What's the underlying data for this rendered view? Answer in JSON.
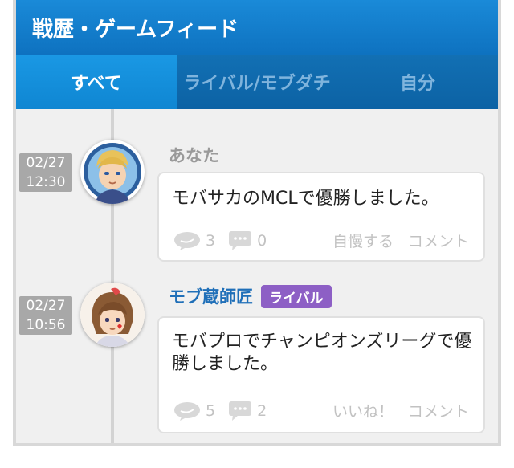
{
  "header": {
    "title": "戦歴・ゲームフィード"
  },
  "tabs": [
    {
      "label": "すべて",
      "active": true
    },
    {
      "label": "ライバル/モブダチ",
      "active": false
    },
    {
      "label": "自分",
      "active": false
    }
  ],
  "feed": [
    {
      "date": "02/27",
      "time": "12:30",
      "author": "あなた",
      "message": "モバサカのMCLで優勝しました。",
      "reactions_count": "3",
      "comments_count": "0",
      "primary_action": "自慢する",
      "comment_action": "コメント"
    },
    {
      "date": "02/27",
      "time": "10:56",
      "author": "モブ蔵師匠",
      "badge": "ライバル",
      "message": "モバプロでチャンピオンズリーグで優勝しました。",
      "reactions_count": "5",
      "comments_count": "2",
      "primary_action": "いいね！",
      "comment_action": "コメント"
    }
  ],
  "colors": {
    "header": "#1a8ad8",
    "tab_active": "#1a98e4",
    "author_link": "#1f6fb8",
    "badge": "#8d5fc5"
  }
}
